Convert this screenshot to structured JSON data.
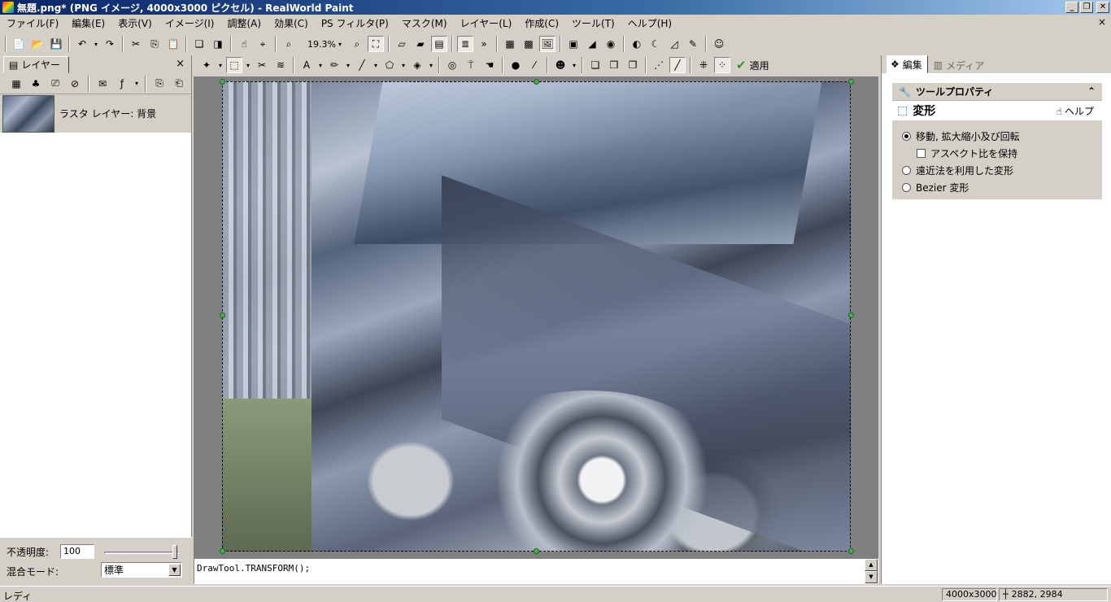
{
  "window": {
    "title": "無題.png* (PNG イメージ, 4000x3000 ピクセル) - RealWorld Paint",
    "controls": {
      "minimize": "_",
      "restore": "❐",
      "close": "✕"
    }
  },
  "menu": {
    "items": [
      "ファイル(F)",
      "編集(E)",
      "表示(V)",
      "イメージ(I)",
      "調整(A)",
      "効果(C)",
      "PS フィルタ(P)",
      "マスク(M)",
      "レイヤー(L)",
      "作成(C)",
      "ツール(T)",
      "ヘルプ(H)"
    ],
    "doc_close": "×"
  },
  "toolbar": {
    "zoom": "19.3%",
    "apply_label": "適用"
  },
  "layers_panel": {
    "tab_label": "レイヤー",
    "close": "×",
    "layer_name": "ラスタ レイヤー: 背景",
    "opacity_label": "不透明度:",
    "opacity_value": "100",
    "blend_label": "混合モード:",
    "blend_value": "標準"
  },
  "console": {
    "script": "DrawTool.TRANSFORM();"
  },
  "right_panel": {
    "tabs": [
      "編集",
      "メディア"
    ],
    "tool_properties_title": "ツールプロパティ",
    "tool_name": "変形",
    "help_label": "ヘルプ",
    "options": {
      "move_scale_rotate": "移動, 拡大縮小及び回転",
      "keep_aspect": "アスペクト比を保持",
      "perspective": "遠近法を利用した変形",
      "bezier": "Bezier 変形"
    },
    "selected_option": "move_scale_rotate",
    "keep_aspect_checked": false
  },
  "status": {
    "text": "レディ",
    "image_size": "4000x3000",
    "cursor_pos": "2882, 2984"
  },
  "colors": {
    "title_gradient_start": "#0a246a",
    "title_gradient_end": "#a6caf0",
    "chrome": "#d4d0c8",
    "canvas_bg": "#808080",
    "handle": "#4caf50",
    "apply_check": "#2a9a2a"
  }
}
